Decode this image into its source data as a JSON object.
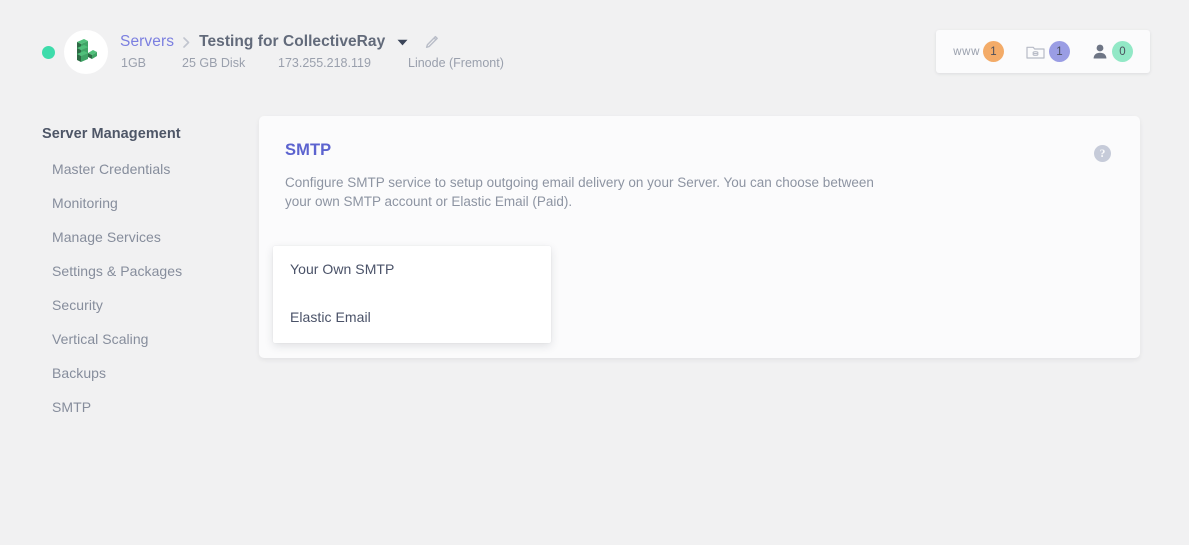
{
  "header": {
    "status": "online",
    "avatar_icon": "server-blocks-logo",
    "breadcrumb": {
      "parent_label": "Servers",
      "separator": "›",
      "current_label": "Testing for CollectiveRay",
      "caret_icon": "chevron-down-icon",
      "edit_icon": "pencil-icon"
    },
    "meta": {
      "ram": "1GB",
      "disk": "25 GB Disk",
      "ip": "173.255.218.119",
      "provider": "Linode (Fremont)"
    },
    "counters": [
      {
        "label": "www",
        "icon": "www-text-icon",
        "value": "1",
        "color": "#f3ab68",
        "name": "apps-counter"
      },
      {
        "label": "",
        "icon": "database-folder-icon",
        "value": "1",
        "color": "#9a9de4",
        "name": "databases-counter"
      },
      {
        "label": "",
        "icon": "user-icon",
        "value": "0",
        "color": "#92e8c6",
        "name": "users-counter"
      }
    ]
  },
  "sidebar": {
    "title": "Server Management",
    "items": [
      {
        "label": "Master Credentials",
        "name": "sidebar-item-master-credentials"
      },
      {
        "label": "Monitoring",
        "name": "sidebar-item-monitoring"
      },
      {
        "label": "Manage Services",
        "name": "sidebar-item-manage-services"
      },
      {
        "label": "Settings & Packages",
        "name": "sidebar-item-settings-packages"
      },
      {
        "label": "Security",
        "name": "sidebar-item-security"
      },
      {
        "label": "Vertical Scaling",
        "name": "sidebar-item-vertical-scaling"
      },
      {
        "label": "Backups",
        "name": "sidebar-item-backups"
      },
      {
        "label": "SMTP",
        "name": "sidebar-item-smtp"
      }
    ]
  },
  "card": {
    "title": "SMTP",
    "description": "Configure SMTP service to setup outgoing email delivery on your Server. You can choose between your own SMTP account or Elastic Email (Paid).",
    "help_icon": "question-mark-icon",
    "help_glyph": "?",
    "title_color": "#5c63cf"
  },
  "dropdown": {
    "options": [
      {
        "label": "Your Own SMTP",
        "name": "dropdown-option-your-own-smtp"
      },
      {
        "label": "Elastic Email",
        "name": "dropdown-option-elastic-email"
      }
    ]
  }
}
